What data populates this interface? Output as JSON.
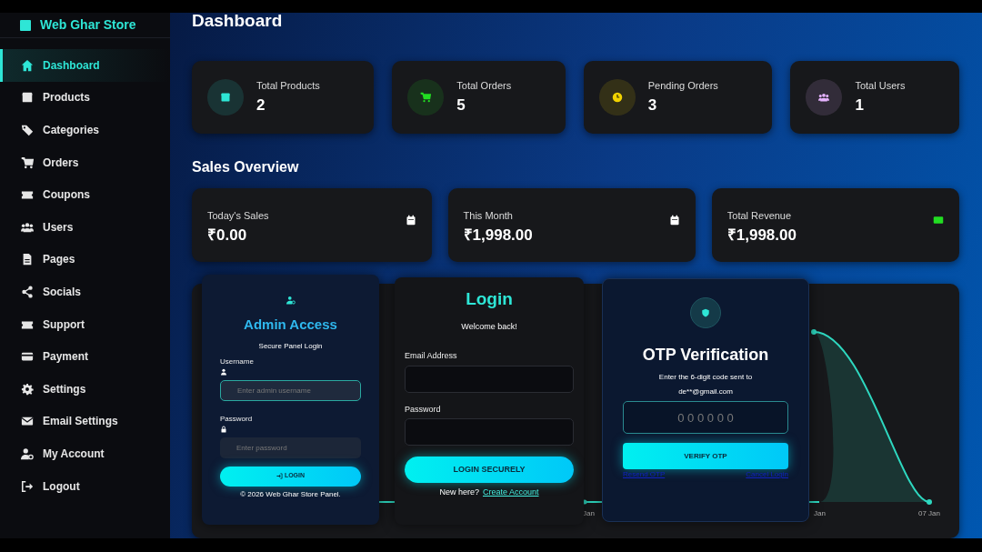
{
  "brand": "Web Ghar Store",
  "sidebar": {
    "items": [
      {
        "label": "Dashboard",
        "selected": true
      },
      {
        "label": "Products",
        "selected": false
      },
      {
        "label": "Categories",
        "selected": false
      },
      {
        "label": "Orders",
        "selected": false
      },
      {
        "label": "Coupons",
        "selected": false
      },
      {
        "label": "Users",
        "selected": false
      },
      {
        "label": "Pages",
        "selected": false
      },
      {
        "label": "Socials",
        "selected": false
      },
      {
        "label": "Support",
        "selected": false
      },
      {
        "label": "Payment",
        "selected": false
      },
      {
        "label": "Settings",
        "selected": false
      },
      {
        "label": "Email Settings",
        "selected": false
      },
      {
        "label": "My Account",
        "selected": false
      },
      {
        "label": "Logout",
        "selected": false
      }
    ]
  },
  "page_title": "Dashboard",
  "stats": [
    {
      "label": "Total Products",
      "value": "2",
      "color": "#2ee6d6"
    },
    {
      "label": "Total Orders",
      "value": "5",
      "color": "#22dd22"
    },
    {
      "label": "Pending Orders",
      "value": "3",
      "color": "#f2d200"
    },
    {
      "label": "Total Users",
      "value": "1",
      "color": "#e6b3ff"
    }
  ],
  "sales_title": "Sales Overview",
  "sales": [
    {
      "label": "Today's Sales",
      "value": "₹0.00",
      "color": "#ffffff"
    },
    {
      "label": "This Month",
      "value": "₹1,998.00",
      "color": "#ffffff"
    },
    {
      "label": "Total Revenue",
      "value": "₹1,998.00",
      "color": "#22dd22"
    }
  ],
  "chart": {
    "x_labels": [
      "Jan",
      "Jan",
      "07 Jan"
    ]
  },
  "admin_login": {
    "title": "Admin Access",
    "subtitle": "Secure Panel Login",
    "username_label": "Username",
    "username_placeholder": "Enter admin username",
    "password_label": "Password",
    "password_placeholder": "Enter password",
    "button": "LOGIN",
    "footer": "© 2026 Web Ghar Store Panel."
  },
  "login": {
    "title": "Login",
    "subtitle": "Welcome back!",
    "email_label": "Email Address",
    "password_label": "Password",
    "button": "LOGIN SECURELY",
    "prompt": "New here?",
    "link": "Create Account"
  },
  "otp": {
    "title": "OTP Verification",
    "message": "Enter the 6-digit code sent to",
    "email": "de**@gmail.com",
    "placeholder": "0 0 0 0 0 0",
    "button": "VERIFY OTP",
    "links": [
      "Resend OTP",
      "Cancel Login"
    ]
  }
}
